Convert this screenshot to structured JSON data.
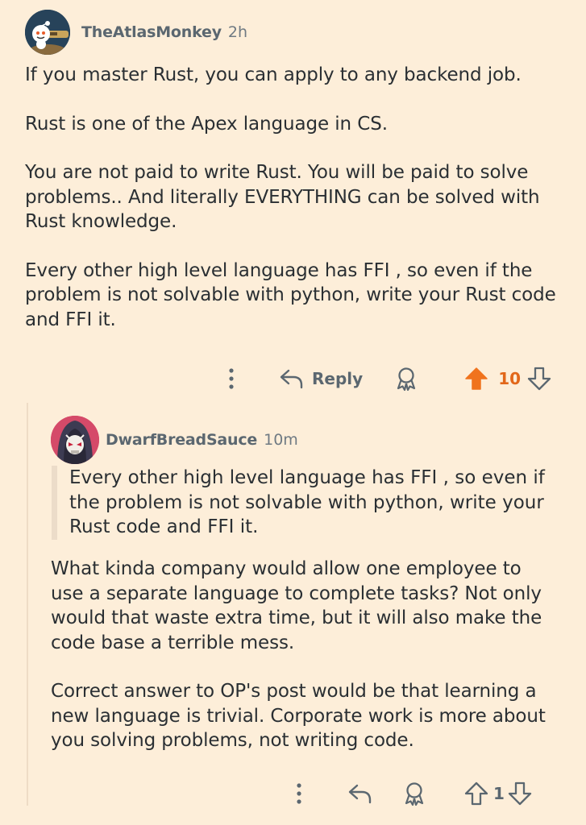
{
  "comment_1": {
    "username": "TheAtlasMonkey",
    "time": "2h",
    "paragraphs": [
      "If you master Rust, you can apply to any backend job.",
      "Rust is one of the Apex language in CS.",
      "You are not paid to write Rust. You will be paid to solve problems.. And literally EVERYTHING can be solved with Rust knowledge.",
      "Every other high level language has FFI , so even if the problem is not solvable with python, write your Rust code and FFI it."
    ],
    "actions": {
      "more_icon": "more-vertical-icon",
      "reply_icon": "reply-arrow-icon",
      "reply_label": "Reply",
      "award_icon": "award-icon",
      "upvote_icon": "upvote-filled-icon",
      "score": "10",
      "downvote_icon": "downvote-icon"
    }
  },
  "comment_2": {
    "username": "DwarfBreadSauce",
    "time": "10m",
    "quote": "Every other high level language has FFI , so even if the problem is not solvable with python, write your Rust code and FFI it.",
    "paragraphs": [
      "What kinda company would allow one employee to use a separate language to complete tasks? Not only would that waste extra time, but it will also make the code base a terrible mess.",
      "Correct answer to OP's post would be that learning a new language is trivial. Corporate work is more about you solving problems, not writing code."
    ],
    "actions": {
      "more_icon": "more-vertical-icon",
      "reply_icon": "reply-arrow-icon",
      "award_icon": "award-icon",
      "upvote_icon": "upvote-outline-icon",
      "score": "1",
      "downvote_icon": "downvote-icon"
    }
  },
  "colors": {
    "background": "#fdeed9",
    "upvoted": "#f0731d",
    "muted": "#5b6770"
  }
}
